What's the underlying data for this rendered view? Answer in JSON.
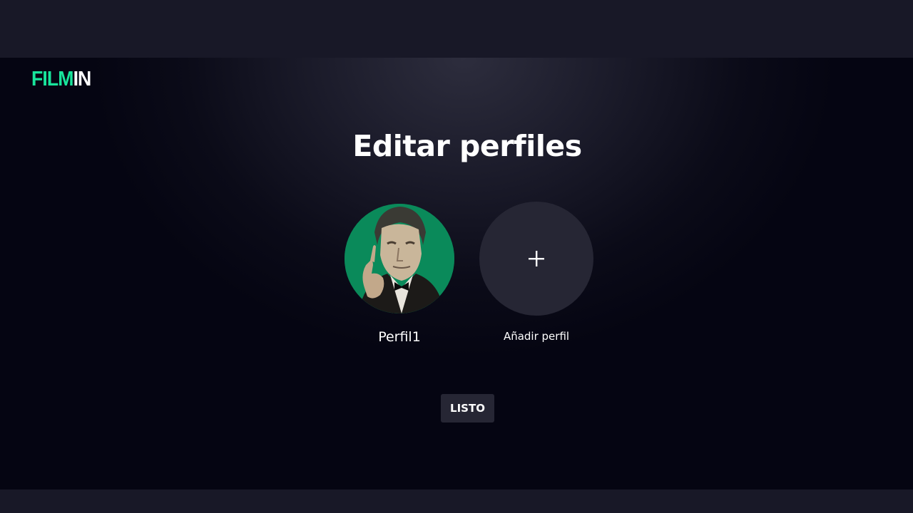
{
  "brand": {
    "logo_part_a": "FILM",
    "logo_part_b": "IN",
    "accent_color": "#18e59b"
  },
  "page": {
    "title": "Editar perfiles"
  },
  "profiles": [
    {
      "name": "Perfil1",
      "avatar_bg": "#0a8a5a",
      "action_icon": "pencil-icon"
    }
  ],
  "add_profile": {
    "label": "Añadir perfil",
    "icon": "plus-icon"
  },
  "actions": {
    "done_label": "LISTO"
  }
}
